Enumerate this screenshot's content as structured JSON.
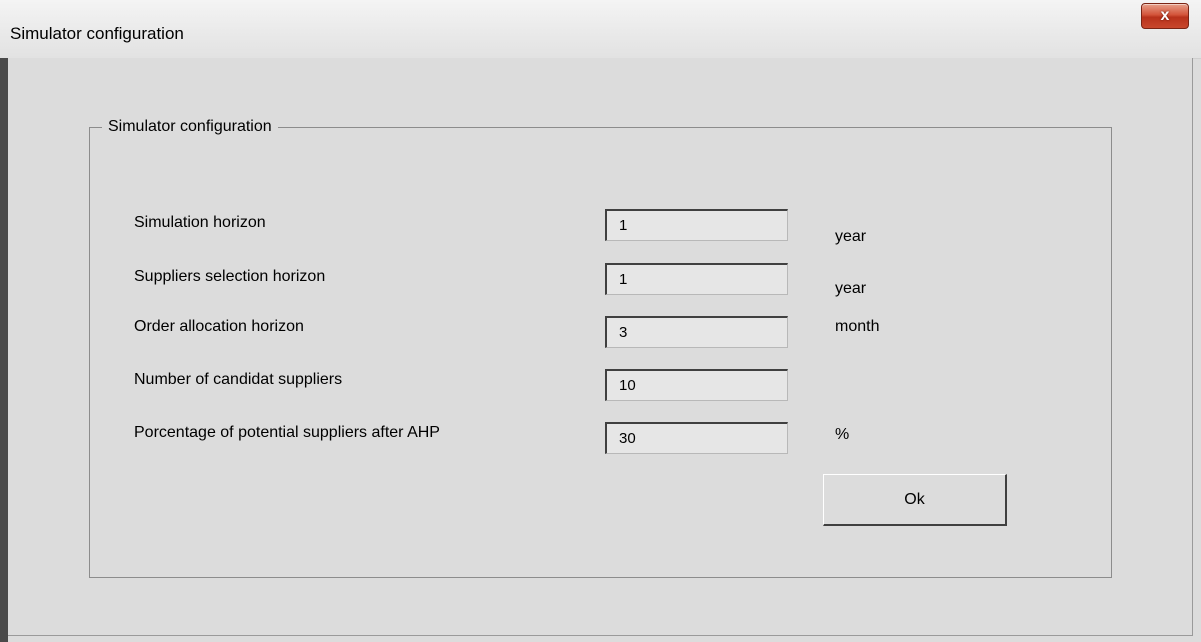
{
  "window": {
    "title": "Simulator configuration",
    "close_label": "x"
  },
  "groupbox": {
    "legend": "Simulator configuration"
  },
  "fields": [
    {
      "label": "Simulation horizon",
      "value": "1",
      "unit": "year"
    },
    {
      "label": "Suppliers selection horizon",
      "value": "1",
      "unit": "year"
    },
    {
      "label": "Order allocation horizon",
      "value": "3",
      "unit": "month"
    },
    {
      "label": "Number of  candidat suppliers",
      "value": "10",
      "unit": ""
    },
    {
      "label": "Porcentage of potential suppliers after AHP",
      "value": "30",
      "unit": "%"
    }
  ],
  "buttons": {
    "ok_label": "Ok"
  },
  "colors": {
    "dialog_background": "#dcdcdc",
    "close_button": "#c8472c"
  }
}
